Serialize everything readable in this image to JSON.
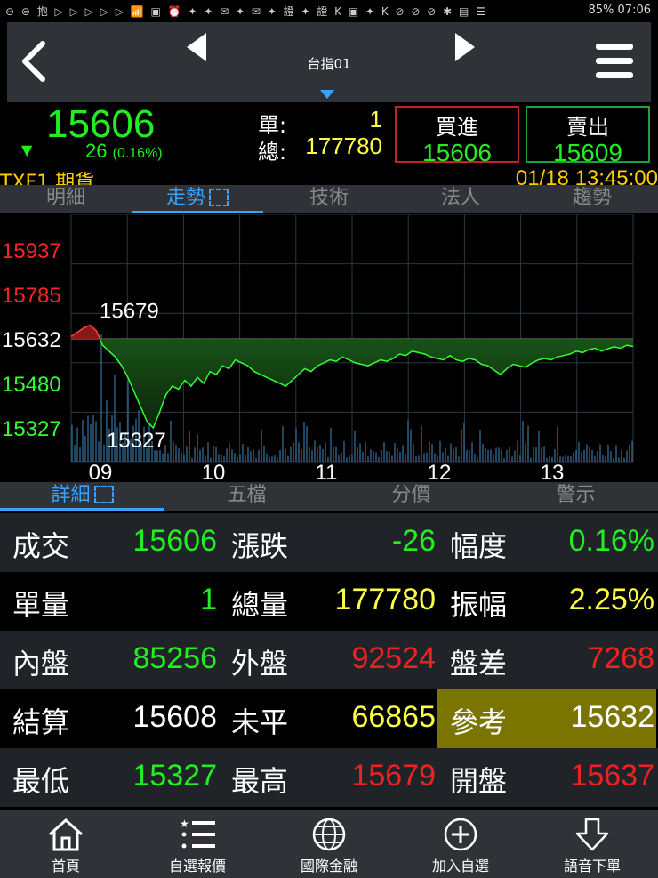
{
  "status_bar": {
    "battery": "85%",
    "time": "07:06",
    "icons": "⊖ ⊜ 抱 ▷ ▷ ▷ ▷ ▷ 📶 ▣ ⏰ ✦ ✦ ✉ ✦ ✉ ✦ 證 ✦ 證 K ▣ ✦ K ⊘ ⊘ ⊘ ✱ ▤ ☰"
  },
  "nav": {
    "title": "台指01"
  },
  "quote": {
    "price": "15606",
    "change": "26",
    "change_pct": "(0.16%)",
    "single_label": "單:",
    "single_value": "1",
    "total_label": "總:",
    "total_value": "177780",
    "buy_label": "買進",
    "buy_value": "15606",
    "sell_label": "賣出",
    "sell_value": "15609",
    "code": "TXF1   期貨",
    "datetime": "01/18 13:45:00"
  },
  "tabs_top": [
    {
      "label": "明細"
    },
    {
      "label": "走勢"
    },
    {
      "label": "技術"
    },
    {
      "label": "法人"
    },
    {
      "label": "趨勢"
    }
  ],
  "chart_data": {
    "type": "line",
    "y_ticks": [
      "15937",
      "15785",
      "15632",
      "15480",
      "15327"
    ],
    "y_tick_values": [
      15937,
      15785,
      15632,
      15480,
      15327
    ],
    "x_ticks": [
      "09",
      "10",
      "11",
      "12",
      "13"
    ],
    "ylim": [
      15327,
      15937
    ],
    "reference": 15632,
    "high_label": "15679",
    "low_label": "15327",
    "series": [
      {
        "values": [
          15640,
          15655,
          15670,
          15679,
          15660,
          15610,
          15590,
          15570,
          15540,
          15500,
          15450,
          15400,
          15350,
          15327,
          15380,
          15440,
          15470,
          15460,
          15490,
          15470,
          15500,
          15480,
          15520,
          15510,
          15540,
          15530,
          15560,
          15550,
          15540,
          15520,
          15510,
          15500,
          15490,
          15480,
          15470,
          15490,
          15510,
          15530,
          15520,
          15540,
          15550,
          15560,
          15555,
          15570,
          15560,
          15550,
          15545,
          15540,
          15550,
          15560,
          15555,
          15565,
          15580,
          15575,
          15590,
          15585,
          15580,
          15570,
          15565,
          15560,
          15575,
          15560,
          15555,
          15565,
          15560,
          15545,
          15540,
          15525,
          15510,
          15530,
          15545,
          15540,
          15535,
          15550,
          15560,
          15565,
          15560,
          15570,
          15575,
          15580,
          15590,
          15585,
          15595,
          15600,
          15590,
          15598,
          15605,
          15600,
          15610,
          15606
        ]
      }
    ]
  },
  "tabs_mid": [
    {
      "label": "詳細"
    },
    {
      "label": "五檔"
    },
    {
      "label": "分價"
    },
    {
      "label": "警示"
    }
  ],
  "detail": {
    "rows": [
      {
        "l1": "成交",
        "v1": "15606",
        "l2": "漲跌",
        "v2": "-26",
        "l3": "幅度",
        "v3": "0.16%"
      },
      {
        "l1": "單量",
        "v1": "1",
        "l2": "總量",
        "v2": "177780",
        "l3": "振幅",
        "v3": "2.25%"
      },
      {
        "l1": "內盤",
        "v1": "85256",
        "l2": "外盤",
        "v2": "92524",
        "l3": "盤差",
        "v3": "7268"
      },
      {
        "l1": "結算",
        "v1": "15608",
        "l2": "未平",
        "v2": "66865",
        "l3": "參考",
        "v3": "15632"
      },
      {
        "l1": "最低",
        "v1": "15327",
        "l2": "最高",
        "v2": "15679",
        "l3": "開盤",
        "v3": "15637"
      }
    ]
  },
  "bottom_nav": [
    {
      "label": "首頁",
      "icon": "home-icon"
    },
    {
      "label": "自選報價",
      "icon": "list-icon"
    },
    {
      "label": "國際金融",
      "icon": "globe-icon"
    },
    {
      "label": "加入自選",
      "icon": "plus-circle-icon"
    },
    {
      "label": "語音下單",
      "icon": "download-arrow-icon"
    }
  ]
}
